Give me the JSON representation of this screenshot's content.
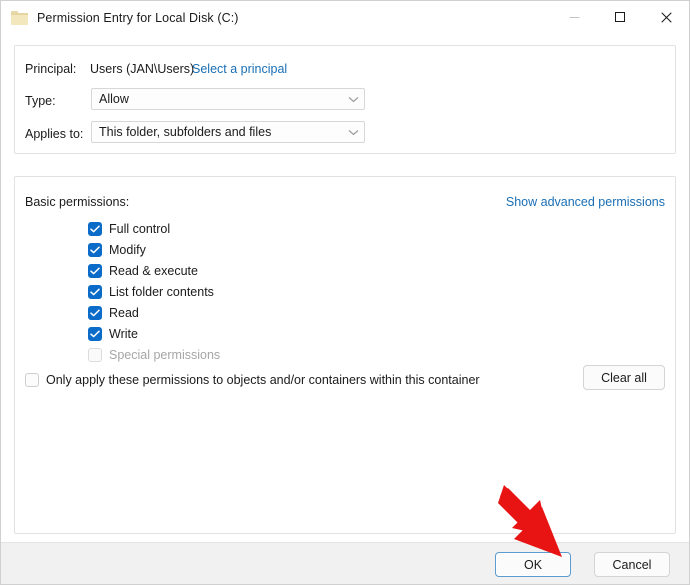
{
  "window": {
    "title": "Permission Entry for Local Disk (C:)",
    "folder_icon": "folder-icon",
    "controls": {
      "minimize": "minimize-icon",
      "maximize": "maximize-icon",
      "close": "close-icon"
    }
  },
  "principal_group": {
    "principal_label": "Principal:",
    "principal_value": "Users (JAN\\Users)",
    "select_principal_link": "Select a principal",
    "type_label": "Type:",
    "type_value": "Allow",
    "applies_to_label": "Applies to:",
    "applies_to_value": "This folder, subfolders and files"
  },
  "permissions_group": {
    "basic_label": "Basic permissions:",
    "advanced_link": "Show advanced permissions",
    "items": [
      {
        "label": "Full control",
        "checked": true,
        "disabled": false
      },
      {
        "label": "Modify",
        "checked": true,
        "disabled": false
      },
      {
        "label": "Read & execute",
        "checked": true,
        "disabled": false
      },
      {
        "label": "List folder contents",
        "checked": true,
        "disabled": false
      },
      {
        "label": "Read",
        "checked": true,
        "disabled": false
      },
      {
        "label": "Write",
        "checked": true,
        "disabled": false
      },
      {
        "label": "Special permissions",
        "checked": false,
        "disabled": true
      }
    ],
    "only_apply_label": "Only apply these permissions to objects and/or containers within this container",
    "only_apply_checked": false,
    "clear_all_label": "Clear all"
  },
  "footer": {
    "ok_label": "OK",
    "cancel_label": "Cancel"
  },
  "annotation": {
    "arrow": "red-arrow-pointing-to-ok",
    "color": "#e81313"
  },
  "colors": {
    "link": "#1a6fb4",
    "checkbox_accent": "#0a6cc8",
    "footer_bg": "#f1f1f1",
    "panel_border": "#e2e2e2",
    "focus_ring": "#5b9bd0"
  }
}
